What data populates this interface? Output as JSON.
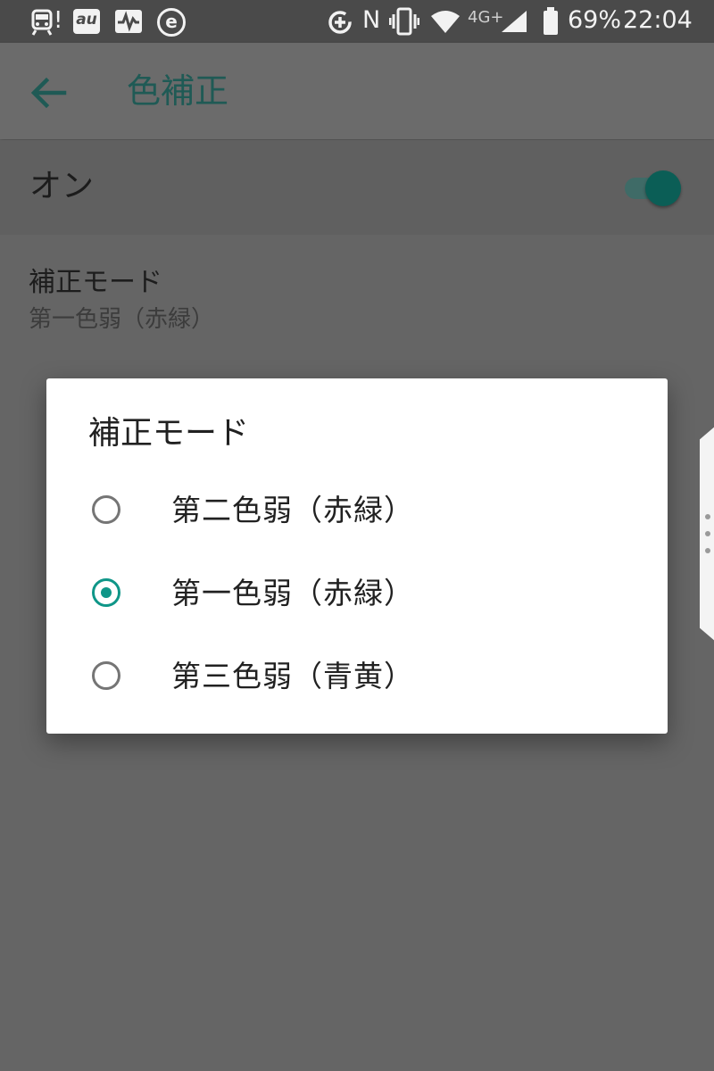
{
  "status_bar": {
    "icons_left": [
      "train-icon",
      "au-icon",
      "activity-icon",
      "e-icon"
    ],
    "icons_right": [
      "data-saver-icon",
      "nfc-icon",
      "vibrate-icon",
      "wifi-icon",
      "signal-icon",
      "battery-icon"
    ],
    "notification_mark": "!",
    "au_label": "au",
    "e_label": "e",
    "nfc_label": "N",
    "network_type": "4G+",
    "battery": "69%",
    "time": "22:04"
  },
  "app_bar": {
    "title": "色補正"
  },
  "main_switch": {
    "label": "オン",
    "checked": true
  },
  "mode_pref": {
    "title": "補正モード",
    "summary": "第一色弱（赤緑）"
  },
  "dialog": {
    "title": "補正モード",
    "options": [
      {
        "label": "第二色弱（赤緑）",
        "selected": false
      },
      {
        "label": "第一色弱（赤緑）",
        "selected": true
      },
      {
        "label": "第三色弱（青黄）",
        "selected": false
      }
    ]
  },
  "colors": {
    "accent": "#0f9688",
    "scrim": "#656565",
    "dialog_bg": "#ffffff"
  }
}
